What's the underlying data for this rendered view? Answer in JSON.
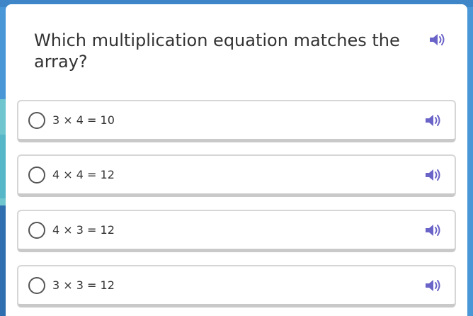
{
  "question": {
    "text": "Which multiplication equation matches the array?"
  },
  "options": [
    {
      "label": "3 × 4 = 10"
    },
    {
      "label": "4 × 4 = 12"
    },
    {
      "label": "4 × 3 = 12"
    },
    {
      "label": "3 × 3 = 12"
    }
  ],
  "icons": {
    "speaker": "speaker-icon",
    "radio": "radio-circle-icon"
  },
  "colors": {
    "background": "#4a97d8",
    "card": "#ffffff",
    "speaker": "#6a63c8",
    "text": "#333333",
    "option_border": "#d6d6d6"
  }
}
